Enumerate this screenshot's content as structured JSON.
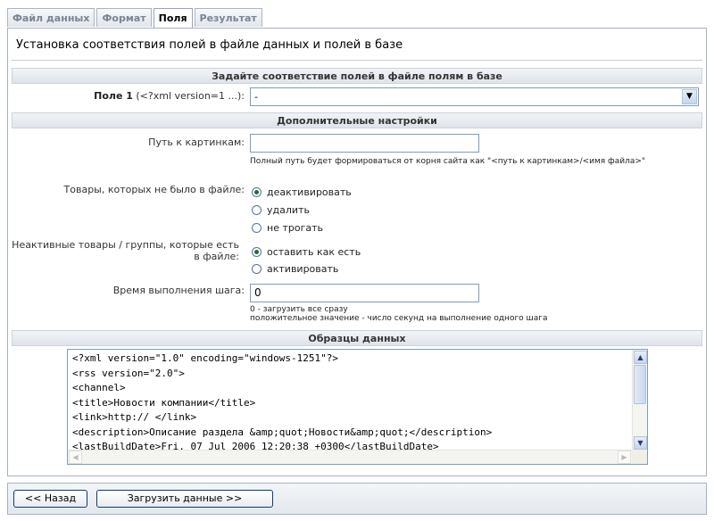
{
  "tabs": [
    "Файл данных",
    "Формат",
    "Поля",
    "Результат"
  ],
  "active_tab": "Поля",
  "title": "Установка соответствия полей в файле данных и полей в базе",
  "section_mapping": "Задайте соответствие полей в файле полям в базе",
  "field1": {
    "label_bold": "Поле 1",
    "label_rest": " (<?xml version=1 ...):",
    "value": "-"
  },
  "section_extra": "Дополнительные настройки",
  "pictures_path": {
    "label": "Путь к картинкам:",
    "value": "",
    "hint": "Полный путь будет формироваться от корня сайта как \"<путь к картинкам>/<имя файла>\""
  },
  "missing_goods": {
    "label": "Товары, которых не было в файле:",
    "options": [
      "деактивировать",
      "удалить",
      "не трогать"
    ],
    "selected": "деактивировать"
  },
  "inactive_goods": {
    "label": "Неактивные товары / группы, которые есть в файле:",
    "options": [
      "оставить как есть",
      "активировать"
    ],
    "selected": "оставить как есть"
  },
  "step_time": {
    "label": "Время выполнения шага:",
    "value": "0",
    "hint1": "0 - загрузить все сразу",
    "hint2": "положительное значение - число секунд на выполнение одного шага"
  },
  "section_samples": "Образцы данных",
  "sample_lines": [
    "<?xml version=\"1.0\" encoding=\"windows-1251\"?>",
    "<rss version=\"2.0\">",
    "<channel>",
    "<title>Новости компании</title>",
    "<link>http:// </link>",
    "<description>Описание раздела &amp;quot;Новости&amp;quot;</description>",
    "<lastBuildDate>Fri, 07 Jul 2006 12:20:38 +0300</lastBuildDate>"
  ],
  "buttons": {
    "back": "<< Назад",
    "load": "Загрузить данные >>"
  }
}
